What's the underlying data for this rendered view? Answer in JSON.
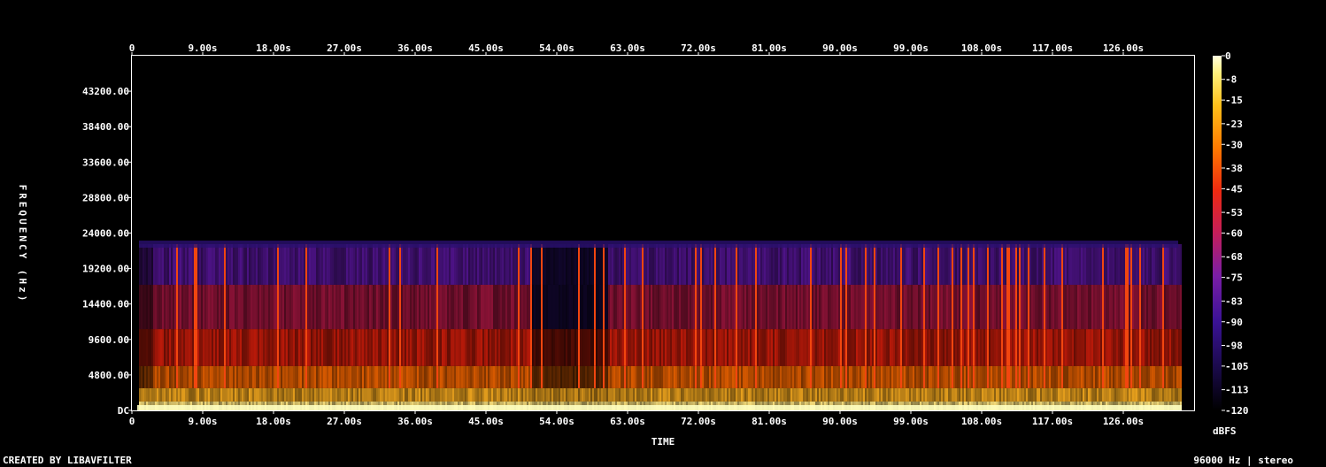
{
  "chart_data": {
    "type": "heatmap",
    "subtype": "spectrogram",
    "xlabel": "TIME",
    "ylabel": "FREQUENCY (Hz)",
    "colorbar_label": "dBFS",
    "x_ticks": [
      "0",
      "9.00s",
      "18.00s",
      "27.00s",
      "36.00s",
      "45.00s",
      "54.00s",
      "63.00s",
      "72.00s",
      "81.00s",
      "90.00s",
      "99.00s",
      "108.00s",
      "117.00s",
      "126.00s"
    ],
    "x_tick_values": [
      0,
      9,
      18,
      27,
      36,
      45,
      54,
      63,
      72,
      81,
      90,
      99,
      108,
      117,
      126
    ],
    "xlim": [
      0,
      135
    ],
    "y_ticks": [
      "DC",
      "4800.00",
      "9600.00",
      "14400.00",
      "19200.00",
      "24000.00",
      "28800.00",
      "33600.00",
      "38400.00",
      "43200.00"
    ],
    "y_tick_values": [
      0,
      4800,
      9600,
      14400,
      19200,
      24000,
      28800,
      33600,
      38400,
      43200
    ],
    "ylim": [
      0,
      48000
    ],
    "colorbar_ticks": [
      "0",
      "-8",
      "-15",
      "-23",
      "-30",
      "-38",
      "-45",
      "-53",
      "-60",
      "-68",
      "-75",
      "-83",
      "-90",
      "-98",
      "-105",
      "-113",
      "-120"
    ],
    "colorbar_tick_values": [
      0,
      -8,
      -15,
      -23,
      -30,
      -38,
      -45,
      -53,
      -60,
      -68,
      -75,
      -83,
      -90,
      -98,
      -105,
      -113,
      -120
    ],
    "colorbar_range": [
      -120,
      0
    ],
    "content_cutoff_hz": 22500,
    "quiet_section_s": [
      50.5,
      60.5
    ],
    "colormap": [
      "#000000",
      "#1a0a4a",
      "#3a1296",
      "#7a1ea6",
      "#c41e5a",
      "#ee2a10",
      "#ff7a00",
      "#ffc01a",
      "#fff07a",
      "#ffffe0"
    ]
  },
  "footer": {
    "left": "CREATED BY LIBAVFILTER",
    "right": "96000 Hz | stereo"
  }
}
